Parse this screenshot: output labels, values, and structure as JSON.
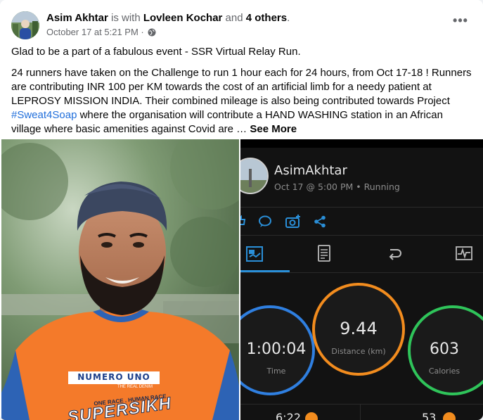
{
  "post": {
    "author": "Asim Akhtar",
    "is_with": "is with",
    "tagged": "Lovleen Kochar",
    "and": "and",
    "others": "4 others",
    "period": ".",
    "timestamp": "October 17 at 5:21 PM",
    "dot": "·",
    "paragraph1": "Glad to be a part of a fabulous event - SSR Virtual Relay Run.",
    "paragraph2_a": "24 runners have taken on the Challenge to run 1 hour each for 24 hours, from Oct 17-18 ! Runners are contributing INR 100 per KM towards the cost of an artificial limb for a needy patient at LEPROSY MISSION INDIA. Their combined mileage is also being contributed towards Project ",
    "hashtag": "#Sweat4Soap",
    "paragraph2_b": " where the organisation will contribute a HAND WASHING station in an African village where basic amenities against Covid are … ",
    "see_more": "See More",
    "more_icon": "•••"
  },
  "photo_left": {
    "shirt_brand": "NUMERO UNO",
    "shirt_sub": "THE REAL DENIM",
    "shirt_line": "ONE RACE . HUMAN RACE",
    "shirt_big": "SUPERSIKH"
  },
  "activity": {
    "user": "AsimAkhtar",
    "when": "Oct 17 @ 5:00 PM • Running",
    "time_value": "1:00:04",
    "time_label": "Time",
    "distance_value": "9.44",
    "distance_label": "Distance (km)",
    "calories_value": "603",
    "calories_label": "Calories",
    "bottom_left": "6:22",
    "bottom_right": "53",
    "colors": {
      "time_ring": "#2f7fe0",
      "distance_ring": "#f28c1e",
      "calories_ring": "#2fc45a",
      "accent": "#2a8fd8"
    }
  }
}
